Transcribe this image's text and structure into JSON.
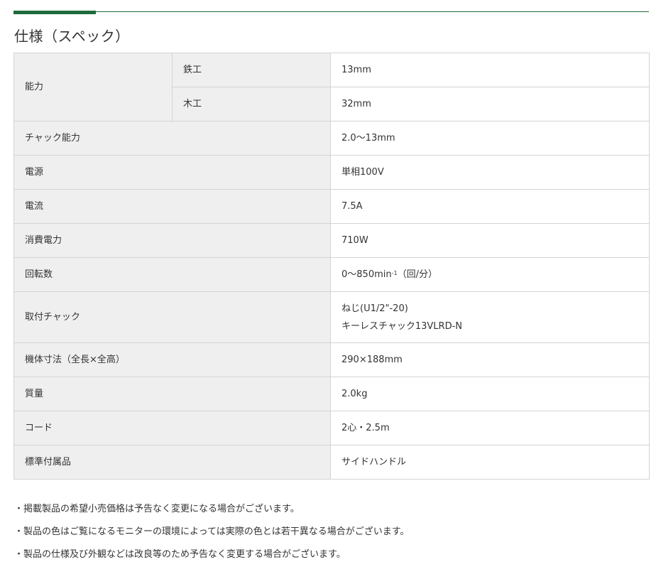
{
  "section_title": "仕様（スペック）",
  "spec": {
    "capacity": {
      "label": "能力",
      "iron_label": "鉄工",
      "iron_value": "13mm",
      "wood_label": "木工",
      "wood_value": "32mm"
    },
    "chuck_capacity": {
      "label": "チャック能力",
      "value": "2.0〜13mm"
    },
    "power_supply": {
      "label": "電源",
      "value": "単相100V"
    },
    "current": {
      "label": "電流",
      "value": "7.5A"
    },
    "power_consumption": {
      "label": "消費電力",
      "value": "710W"
    },
    "rotation": {
      "label": "回転数",
      "value_pre": "0〜850min",
      "value_sup": "-1",
      "value_post": "（回/分）"
    },
    "mounting_chuck": {
      "label": "取付チャック",
      "value_line1": "ねじ(U1/2\"-20)",
      "value_line2": "キーレスチャック13VLRD-N"
    },
    "dimensions": {
      "label": "機体寸法（全長×全高）",
      "value": "290×188mm"
    },
    "weight": {
      "label": "質量",
      "value": "2.0kg"
    },
    "cord": {
      "label": "コード",
      "value": "2心・2.5m"
    },
    "accessories": {
      "label": "標準付属品",
      "value": "サイドハンドル"
    }
  },
  "notes": [
    "・掲載製品の希望小売価格は予告なく変更になる場合がございます。",
    "・製品の色はご覧になるモニターの環境によっては実際の色とは若干異なる場合がございます。",
    "・製品の仕様及び外観などは改良等のため予告なく変更する場合がございます。"
  ],
  "colors": {
    "accent": "#1e6a3c",
    "header_bg": "#efefef",
    "border": "#d4d4d4",
    "text": "#333333"
  }
}
